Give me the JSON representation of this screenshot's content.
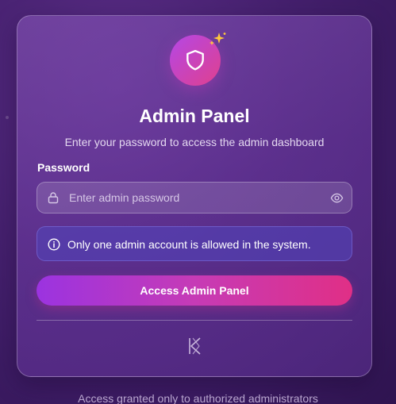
{
  "header": {
    "title": "Admin Panel",
    "subtitle": "Enter your password to access the admin dashboard",
    "logo_icon": "shield-icon",
    "badge_icon": "sparkles-icon"
  },
  "form": {
    "password_label": "Password",
    "password_placeholder": "Enter admin password",
    "password_value": "",
    "lock_icon": "lock-icon",
    "toggle_icon": "eye-icon"
  },
  "notice": {
    "icon": "info-icon",
    "text": "Only one admin account is allowed in the system."
  },
  "actions": {
    "submit_label": "Access Admin Panel"
  },
  "footer": {
    "text": "Access granted only to authorized administrators"
  },
  "colors": {
    "background": "#45206e",
    "accent_start": "#9b33e0",
    "accent_end": "#e02f86",
    "notice_bg": "#5046be"
  }
}
